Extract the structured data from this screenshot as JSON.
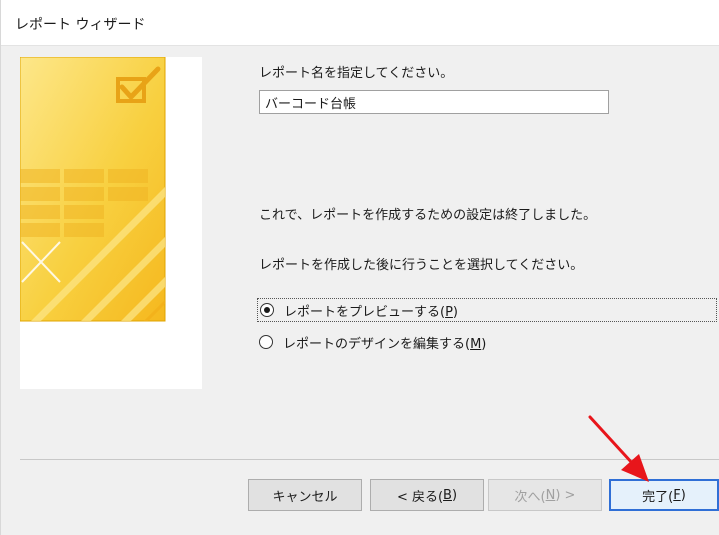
{
  "window": {
    "title": "レポート ウィザード"
  },
  "prompt": {
    "name_label": "レポート名を指定してください。",
    "name_value": "バーコード台帳",
    "finish_message": "これで、レポートを作成するための設定は終了しました。",
    "next_action_label": "レポートを作成した後に行うことを選択してください。"
  },
  "options": [
    {
      "label": "レポートをプレビューする(",
      "accel": "P",
      "suffix": ")",
      "checked": true
    },
    {
      "label": "レポートのデザインを編集する(",
      "accel": "M",
      "suffix": ")",
      "checked": false
    }
  ],
  "buttons": {
    "cancel": {
      "label": "キャンセル"
    },
    "back": {
      "label": "< 戻る(",
      "accel": "B",
      "suffix": ")"
    },
    "next": {
      "label": "次へ(",
      "accel": "N",
      "suffix": ") >"
    },
    "finish": {
      "label": "完了(",
      "accel": "F",
      "suffix": ")"
    }
  },
  "colors": {
    "illustration_yellow": "#f8c830",
    "illustration_light": "#fde78a",
    "annotation_arrow": "#e8151b",
    "default_button_border": "#2f6fd6"
  },
  "icons": {
    "illustration": "report-wizard-checkmark-illustration",
    "annotation": "red-arrow-pointer"
  }
}
